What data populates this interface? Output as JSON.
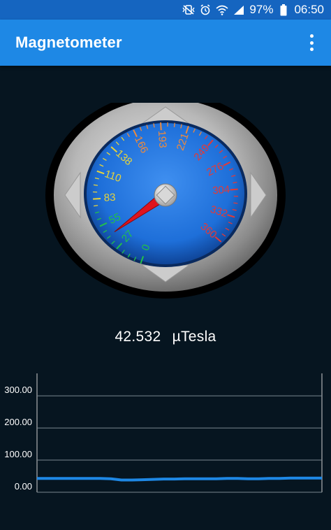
{
  "status_bar": {
    "icons": [
      "mute-vibrate-icon",
      "alarm-icon",
      "wifi-icon",
      "signal-icon"
    ],
    "battery": "97%",
    "time": "06:50"
  },
  "app_bar": {
    "title": "Magnetometer",
    "menu_icon": "more-vertical-icon"
  },
  "gauge": {
    "scale_labels": [
      "0",
      "27",
      "55",
      "83",
      "110",
      "138",
      "166",
      "193",
      "221",
      "249",
      "276",
      "304",
      "332",
      "360"
    ],
    "min": 0,
    "max": 360,
    "needle_value": 42.532,
    "colors": {
      "face": "#1e6fd9",
      "green": "#22c04a",
      "yellow": "#e8d43a",
      "orange": "#f08a3a",
      "red": "#e53935",
      "needle": "#e0141e"
    }
  },
  "reading": {
    "value": "42.532",
    "unit": "µTesla"
  },
  "chart_data": {
    "type": "line",
    "title": "",
    "xlabel": "",
    "ylabel": "",
    "y_tick_labels": [
      "0.00",
      "100.00",
      "200.00",
      "300.00"
    ],
    "ylim": [
      0,
      370
    ],
    "grid": true,
    "series": [
      {
        "values": [
          43,
          43,
          43,
          43,
          43,
          43,
          43,
          42,
          38,
          38,
          39,
          40,
          41,
          41,
          42,
          42,
          42,
          42,
          43,
          43,
          42,
          42,
          43,
          43,
          44,
          44,
          44,
          44
        ]
      }
    ],
    "line_color": "#1e88e5"
  }
}
